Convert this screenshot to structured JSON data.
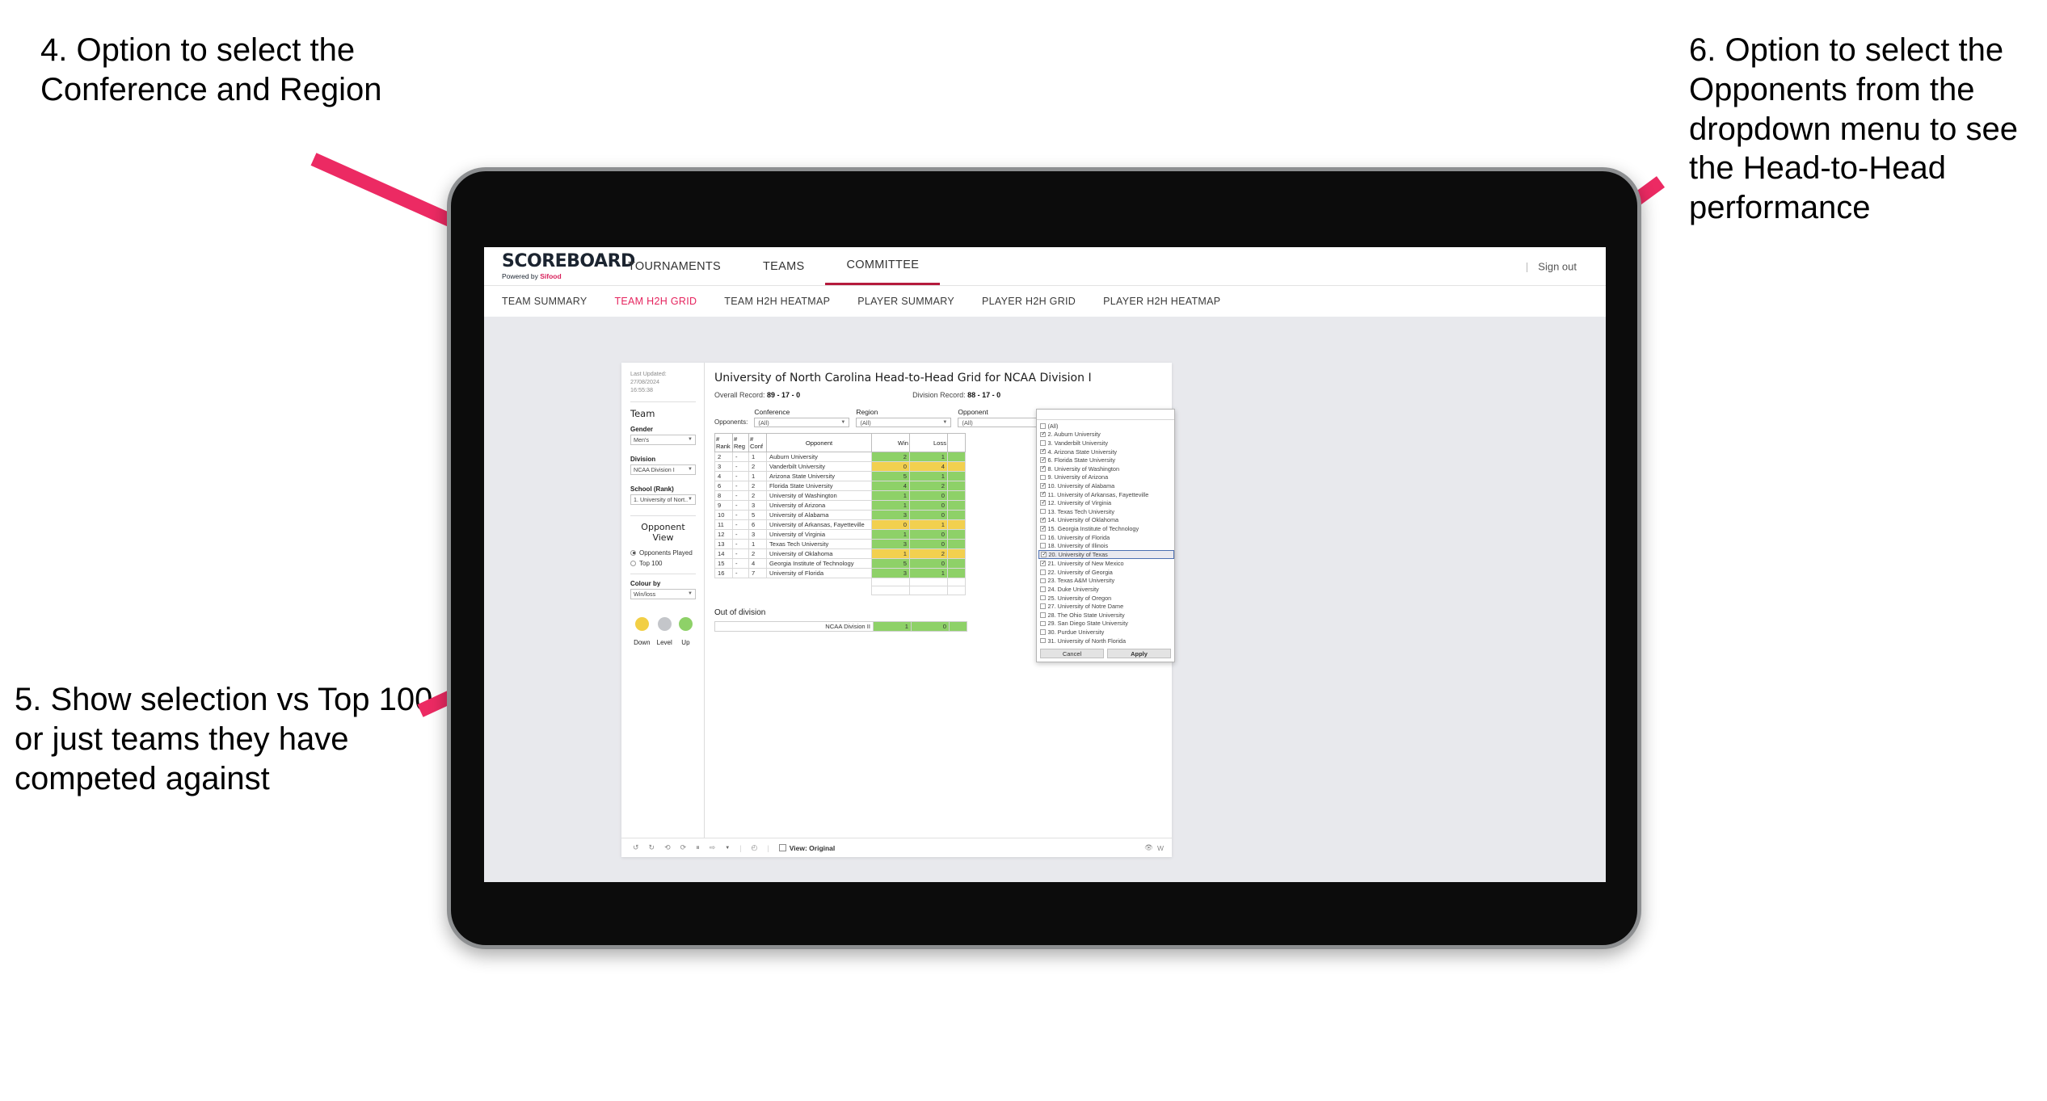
{
  "annotations": {
    "a4": "4. Option to select the Conference and Region",
    "a5": "5. Show selection vs Top 100 or just teams they have competed against",
    "a6": "6. Option to select the Opponents from the dropdown menu to see the Head-to-Head performance",
    "arrow_color": "#ec2a63"
  },
  "app": {
    "logo_main": "SCOREBOARD",
    "logo_sub_prefix": "Powered by ",
    "logo_sub_brand": "Sifood",
    "nav": [
      {
        "label": "TOURNAMENTS",
        "active": false
      },
      {
        "label": "TEAMS",
        "active": false
      },
      {
        "label": "COMMITTEE",
        "active": true
      }
    ],
    "signout": "Sign out",
    "subnav": [
      {
        "label": "TEAM SUMMARY",
        "active": false
      },
      {
        "label": "TEAM H2H GRID",
        "active": true
      },
      {
        "label": "TEAM H2H HEATMAP",
        "active": false
      },
      {
        "label": "PLAYER SUMMARY",
        "active": false
      },
      {
        "label": "PLAYER H2H GRID",
        "active": false
      },
      {
        "label": "PLAYER H2H HEATMAP",
        "active": false
      }
    ]
  },
  "sidebar": {
    "last_updated_line1": "Last Updated: 27/08/2024",
    "last_updated_line2": "16:55:38",
    "team_heading": "Team",
    "gender_label": "Gender",
    "gender_value": "Men's",
    "division_label": "Division",
    "division_value": "NCAA Division I",
    "school_label": "School (Rank)",
    "school_value": "1. University of Nort...",
    "opponent_view_heading": "Opponent View",
    "radio_options": [
      {
        "label": "Opponents Played",
        "selected": true
      },
      {
        "label": "Top 100",
        "selected": false
      }
    ],
    "colour_by_label": "Colour by",
    "colour_by_value": "Win/loss",
    "legend": [
      {
        "label": "Down",
        "color": "#f2cf45"
      },
      {
        "label": "Level",
        "color": "#c4c6ca"
      },
      {
        "label": "Up",
        "color": "#8ed168"
      }
    ]
  },
  "main": {
    "title": "University of North Carolina Head-to-Head Grid for NCAA Division I",
    "overall_record_label": "Overall Record:",
    "overall_record_value": "89 - 17 - 0",
    "division_record_label": "Division Record:",
    "division_record_value": "88 - 17 - 0",
    "opponents_label": "Opponents:",
    "filters": [
      {
        "name": "conference",
        "label": "Conference",
        "value": "(All)"
      },
      {
        "name": "region",
        "label": "Region",
        "value": "(All)"
      },
      {
        "name": "opponent",
        "label": "Opponent",
        "value": "(All)"
      }
    ],
    "columns": [
      "# Rank",
      "# Reg",
      "# Conf",
      "Opponent",
      "Win",
      "Loss"
    ],
    "column_parts": [
      {
        "l1": "#",
        "l2": "Rank"
      },
      {
        "l1": "#",
        "l2": "Reg"
      },
      {
        "l1": "#",
        "l2": "Conf"
      },
      {
        "l1": "",
        "l2": "Opponent"
      },
      {
        "l1": "",
        "l2": "Win"
      },
      {
        "l1": "",
        "l2": "Loss"
      }
    ],
    "rows": [
      {
        "rank": "2",
        "reg": "-",
        "conf": "1",
        "opponent": "Auburn University",
        "win": "2",
        "loss": "1",
        "state": "win"
      },
      {
        "rank": "3",
        "reg": "-",
        "conf": "2",
        "opponent": "Vanderbilt University",
        "win": "0",
        "loss": "4",
        "state": "loss"
      },
      {
        "rank": "4",
        "reg": "-",
        "conf": "1",
        "opponent": "Arizona State University",
        "win": "5",
        "loss": "1",
        "state": "win"
      },
      {
        "rank": "6",
        "reg": "-",
        "conf": "2",
        "opponent": "Florida State University",
        "win": "4",
        "loss": "2",
        "state": "win"
      },
      {
        "rank": "8",
        "reg": "-",
        "conf": "2",
        "opponent": "University of Washington",
        "win": "1",
        "loss": "0",
        "state": "win"
      },
      {
        "rank": "9",
        "reg": "-",
        "conf": "3",
        "opponent": "University of Arizona",
        "win": "1",
        "loss": "0",
        "state": "win"
      },
      {
        "rank": "10",
        "reg": "-",
        "conf": "5",
        "opponent": "University of Alabama",
        "win": "3",
        "loss": "0",
        "state": "win"
      },
      {
        "rank": "11",
        "reg": "-",
        "conf": "6",
        "opponent": "University of Arkansas, Fayetteville",
        "win": "0",
        "loss": "1",
        "state": "loss"
      },
      {
        "rank": "12",
        "reg": "-",
        "conf": "3",
        "opponent": "University of Virginia",
        "win": "1",
        "loss": "0",
        "state": "win"
      },
      {
        "rank": "13",
        "reg": "-",
        "conf": "1",
        "opponent": "Texas Tech University",
        "win": "3",
        "loss": "0",
        "state": "win"
      },
      {
        "rank": "14",
        "reg": "-",
        "conf": "2",
        "opponent": "University of Oklahoma",
        "win": "1",
        "loss": "2",
        "state": "loss"
      },
      {
        "rank": "15",
        "reg": "-",
        "conf": "4",
        "opponent": "Georgia Institute of Technology",
        "win": "5",
        "loss": "0",
        "state": "win"
      },
      {
        "rank": "16",
        "reg": "-",
        "conf": "7",
        "opponent": "University of Florida",
        "win": "3",
        "loss": "1",
        "state": "win"
      }
    ],
    "out_of_division_heading": "Out of division",
    "out_of_division_row": {
      "opponent": "NCAA Division II",
      "win": "1",
      "loss": "0",
      "state": "win"
    }
  },
  "opponent_dropdown": {
    "items": [
      {
        "label": "(All)",
        "checked": false,
        "highlighted": false
      },
      {
        "label": "2. Auburn University",
        "checked": true,
        "highlighted": false
      },
      {
        "label": "3. Vanderbilt University",
        "checked": false,
        "highlighted": false
      },
      {
        "label": "4. Arizona State University",
        "checked": true,
        "highlighted": false
      },
      {
        "label": "6. Florida State University",
        "checked": true,
        "highlighted": false
      },
      {
        "label": "8. University of Washington",
        "checked": true,
        "highlighted": false
      },
      {
        "label": "9. University of Arizona",
        "checked": false,
        "highlighted": false
      },
      {
        "label": "10. University of Alabama",
        "checked": true,
        "highlighted": false
      },
      {
        "label": "11. University of Arkansas, Fayetteville",
        "checked": true,
        "highlighted": false
      },
      {
        "label": "12. University of Virginia",
        "checked": true,
        "highlighted": false
      },
      {
        "label": "13. Texas Tech University",
        "checked": false,
        "highlighted": false
      },
      {
        "label": "14. University of Oklahoma",
        "checked": true,
        "highlighted": false
      },
      {
        "label": "15. Georgia Institute of Technology",
        "checked": true,
        "highlighted": false
      },
      {
        "label": "16. University of Florida",
        "checked": false,
        "highlighted": false
      },
      {
        "label": "18. University of Illinois",
        "checked": false,
        "highlighted": false
      },
      {
        "label": "20. University of Texas",
        "checked": true,
        "highlighted": true
      },
      {
        "label": "21. University of New Mexico",
        "checked": true,
        "highlighted": false
      },
      {
        "label": "22. University of Georgia",
        "checked": false,
        "highlighted": false
      },
      {
        "label": "23. Texas A&M University",
        "checked": false,
        "highlighted": false
      },
      {
        "label": "24. Duke University",
        "checked": false,
        "highlighted": false
      },
      {
        "label": "25. University of Oregon",
        "checked": false,
        "highlighted": false
      },
      {
        "label": "27. University of Notre Dame",
        "checked": false,
        "highlighted": false
      },
      {
        "label": "28. The Ohio State University",
        "checked": false,
        "highlighted": false
      },
      {
        "label": "29. San Diego State University",
        "checked": false,
        "highlighted": false
      },
      {
        "label": "30. Purdue University",
        "checked": false,
        "highlighted": false
      },
      {
        "label": "31. University of North Florida",
        "checked": false,
        "highlighted": false
      }
    ],
    "cancel_label": "Cancel",
    "apply_label": "Apply"
  },
  "toolbar": {
    "view_label": "View: Original",
    "watch_label": "W"
  }
}
